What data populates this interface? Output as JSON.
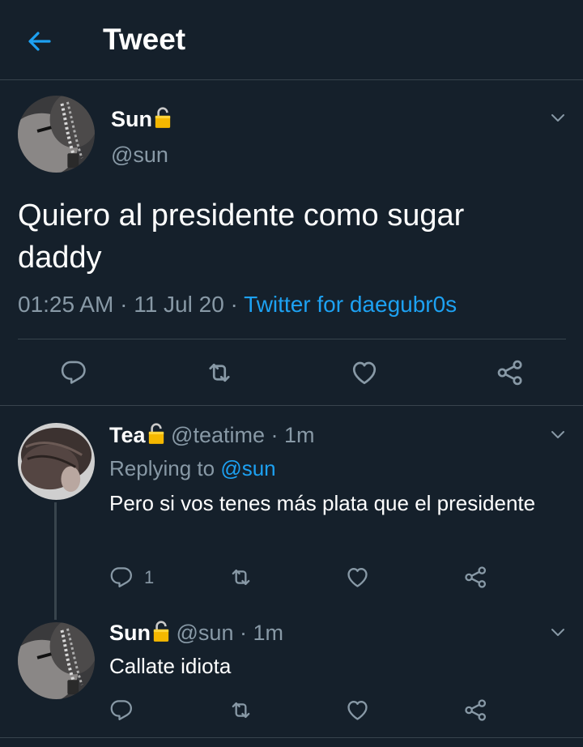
{
  "header": {
    "title": "Tweet",
    "back_icon": "arrow-left-icon",
    "accent": "#1da1f2"
  },
  "main_tweet": {
    "name": "Sun",
    "handle": "@sun",
    "text": "Quiero al presidente como sugar daddy",
    "time": "01:25 AM",
    "date": "11 Jul 20",
    "source": "Twitter for daegubr0s"
  },
  "replies": [
    {
      "name": "Tea",
      "handle": "@teatime",
      "age": "1m",
      "replying_to_label": "Replying to",
      "replying_to_handle": "@sun",
      "text": "Pero si vos tenes más plata que el presidente",
      "reply_count": "1"
    },
    {
      "name": "Sun",
      "handle": "@sun",
      "age": "1m",
      "text": "Callate idiota"
    }
  ],
  "icons": [
    "reply-icon",
    "retweet-icon",
    "like-icon",
    "share-icon",
    "lock-icon",
    "chevron-down-icon"
  ],
  "colors": {
    "background": "#15202b",
    "secondary_text": "#8899a6",
    "divider": "#38444d",
    "lock": "#f5b800"
  }
}
